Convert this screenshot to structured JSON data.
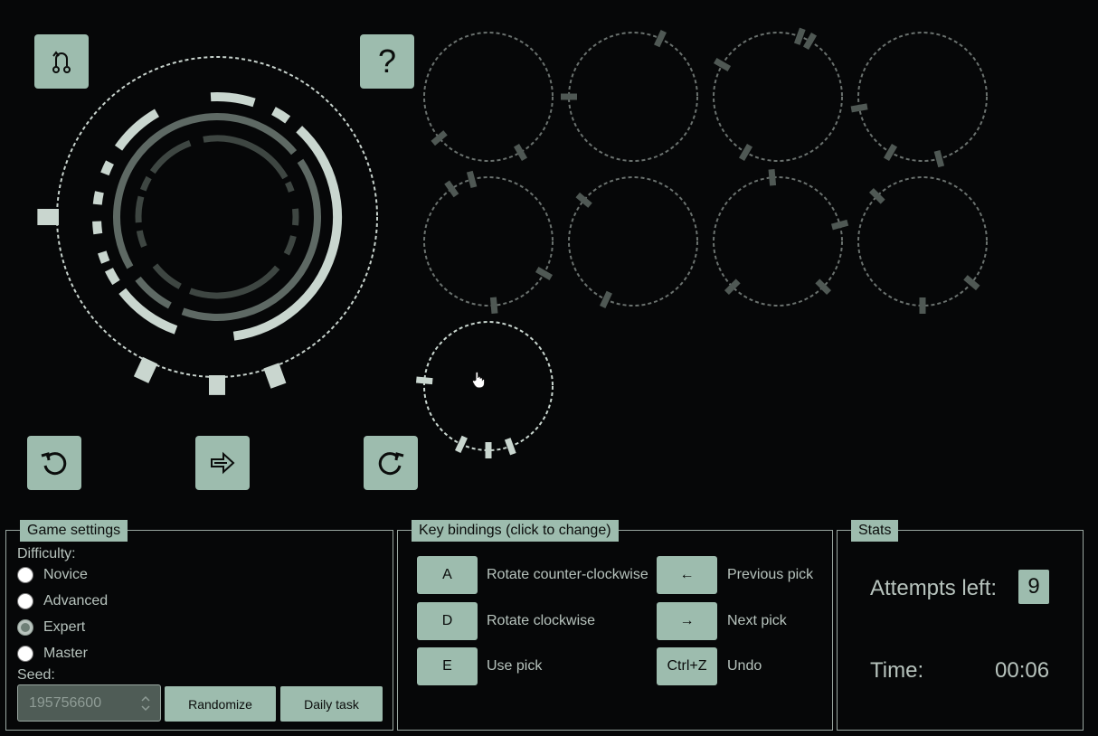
{
  "controls": {
    "reset_icon": "reset-icon",
    "help_label": "?",
    "rotate_ccw_icon": "rotate-ccw-icon",
    "use_pick_icon": "use-pick-icon",
    "rotate_cw_icon": "rotate-cw-icon"
  },
  "colors": {
    "accent": "#9dbcae",
    "ring_mid": "#5e6964",
    "ring_dark": "#3e4642",
    "pick_dash": "#6a716e",
    "pick_tooth": "#4f5854",
    "pick_active": "#c9d6cf",
    "background": "#060708"
  },
  "settings": {
    "legend": "Game settings",
    "difficulty_label": "Difficulty:",
    "options": [
      {
        "label": "Novice",
        "checked": false
      },
      {
        "label": "Advanced",
        "checked": false
      },
      {
        "label": "Expert",
        "checked": true
      },
      {
        "label": "Master",
        "checked": false
      }
    ],
    "seed_label": "Seed:",
    "seed_value": "195756600",
    "randomize_label": "Randomize",
    "daily_label": "Daily task"
  },
  "keys": {
    "legend": "Key bindings (click to change)",
    "bindings": [
      {
        "key": "A",
        "desc": "Rotate counter-clockwise"
      },
      {
        "key": "D",
        "desc": "Rotate clockwise"
      },
      {
        "key": "E",
        "desc": "Use pick"
      },
      {
        "key": "←",
        "desc": "Previous pick"
      },
      {
        "key": "→",
        "desc": "Next pick"
      },
      {
        "key": "Ctrl+Z",
        "desc": "Undo"
      }
    ]
  },
  "stats": {
    "legend": "Stats",
    "attempts_label": "Attempts left:",
    "attempts_value": "9",
    "time_label": "Time:",
    "time_value": "00:06"
  }
}
